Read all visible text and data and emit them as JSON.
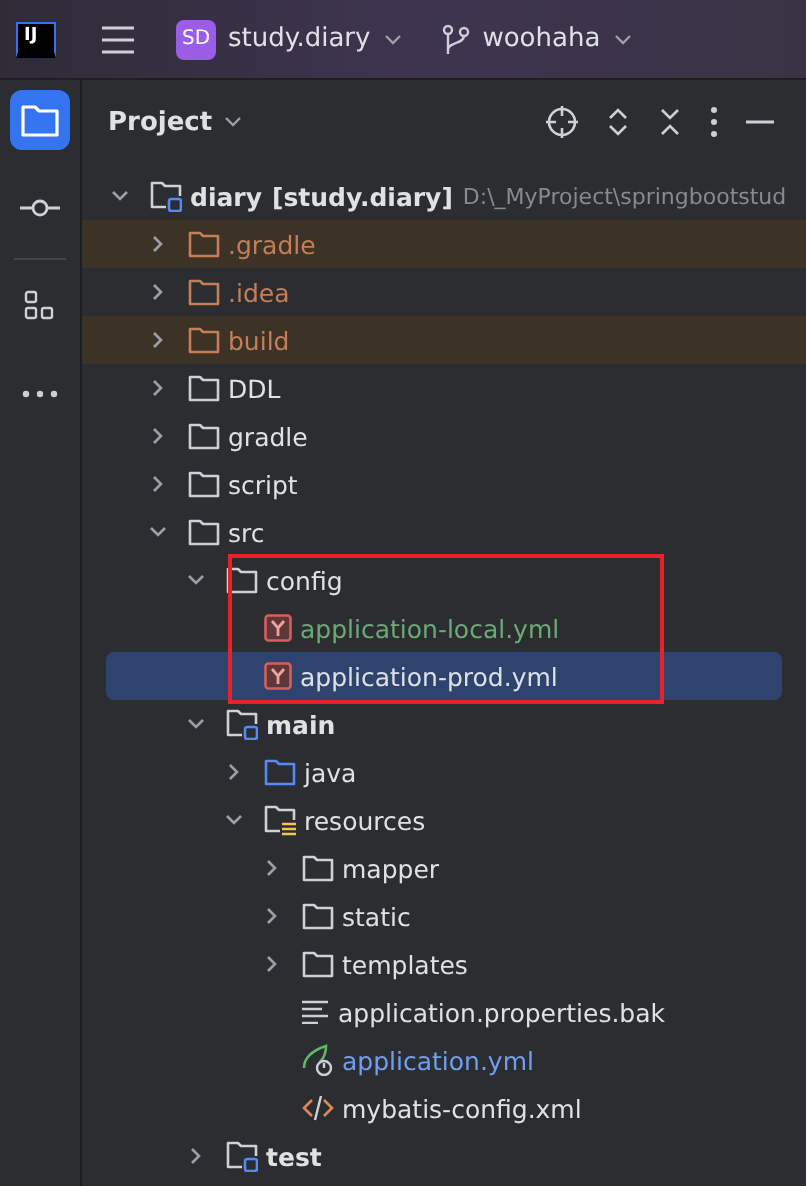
{
  "top_bar": {
    "logo": "IJ",
    "project_badge": "SD",
    "project": "study.diary",
    "branch": "woohaha"
  },
  "tool_window_bar": [
    {
      "kind": "project",
      "selected": true
    },
    {
      "kind": "commit",
      "selected": false
    },
    {
      "kind": "structure",
      "selected": false
    },
    {
      "kind": "more",
      "selected": false
    }
  ],
  "panel": {
    "title": "Project"
  },
  "tree": [
    {
      "name": "diary",
      "module": "[study.diary]",
      "path": "D:\\_MyProject\\springbootstud",
      "kind": "module",
      "color": "#dfe1e5",
      "expanded": true,
      "selected": false,
      "excluded": false,
      "boxed": false,
      "children": [
        {
          "name": ".gradle",
          "kind": "folder",
          "color": "#c77d55",
          "expanded": false,
          "selected": false,
          "excluded": true,
          "boxed": false
        },
        {
          "name": ".idea",
          "kind": "folder",
          "color": "#c77d55",
          "expanded": false,
          "selected": false,
          "excluded": false,
          "boxed": false
        },
        {
          "name": "build",
          "kind": "folder",
          "color": "#c77d55",
          "expanded": false,
          "selected": false,
          "excluded": true,
          "boxed": false
        },
        {
          "name": "DDL",
          "kind": "folder",
          "color": "#dfe1e5",
          "expanded": false,
          "selected": false,
          "excluded": false,
          "boxed": false
        },
        {
          "name": "gradle",
          "kind": "folder",
          "color": "#dfe1e5",
          "expanded": false,
          "selected": false,
          "excluded": false,
          "boxed": false
        },
        {
          "name": "script",
          "kind": "folder",
          "color": "#dfe1e5",
          "expanded": false,
          "selected": false,
          "excluded": false,
          "boxed": false
        },
        {
          "name": "src",
          "kind": "folder",
          "color": "#dfe1e5",
          "expanded": true,
          "selected": false,
          "excluded": false,
          "boxed": false,
          "children": [
            {
              "name": "config",
              "kind": "folder",
              "color": "#dfe1e5",
              "expanded": true,
              "selected": false,
              "excluded": false,
              "boxed": true,
              "children": [
                {
                  "name": "application-local.yml",
                  "kind": "yaml",
                  "color": "#6aab73",
                  "selected": false,
                  "excluded": false,
                  "boxed": false
                },
                {
                  "name": "application-prod.yml",
                  "kind": "yaml",
                  "color": "#dfe1e5",
                  "selected": true,
                  "excluded": false,
                  "boxed": false
                }
              ]
            },
            {
              "name": "main",
              "kind": "module",
              "color": "#dfe1e5",
              "expanded": true,
              "selected": false,
              "excluded": false,
              "boxed": false,
              "children": [
                {
                  "name": "java",
                  "kind": "source",
                  "color": "#dfe1e5",
                  "expanded": false,
                  "selected": false,
                  "excluded": false,
                  "boxed": false
                },
                {
                  "name": "resources",
                  "kind": "resources",
                  "color": "#dfe1e5",
                  "expanded": true,
                  "selected": false,
                  "excluded": false,
                  "boxed": false,
                  "children": [
                    {
                      "name": "mapper",
                      "kind": "folder",
                      "color": "#dfe1e5",
                      "expanded": false,
                      "selected": false,
                      "excluded": false,
                      "boxed": false
                    },
                    {
                      "name": "static",
                      "kind": "folder",
                      "color": "#dfe1e5",
                      "expanded": false,
                      "selected": false,
                      "excluded": false,
                      "boxed": false
                    },
                    {
                      "name": "templates",
                      "kind": "folder",
                      "color": "#dfe1e5",
                      "expanded": false,
                      "selected": false,
                      "excluded": false,
                      "boxed": false
                    },
                    {
                      "name": "application.properties.bak",
                      "kind": "text",
                      "color": "#dfe1e5",
                      "selected": false,
                      "excluded": false,
                      "boxed": false
                    },
                    {
                      "name": "application.yml",
                      "kind": "spring",
                      "color": "#6f9ff5",
                      "selected": false,
                      "excluded": false,
                      "boxed": false
                    },
                    {
                      "name": "mybatis-config.xml",
                      "kind": "xml",
                      "color": "#dfe1e5",
                      "selected": false,
                      "excluded": false,
                      "boxed": false
                    }
                  ]
                }
              ]
            },
            {
              "name": "test",
              "kind": "module",
              "color": "#dfe1e5",
              "expanded": false,
              "selected": false,
              "excluded": false,
              "boxed": false
            }
          ]
        }
      ]
    }
  ]
}
